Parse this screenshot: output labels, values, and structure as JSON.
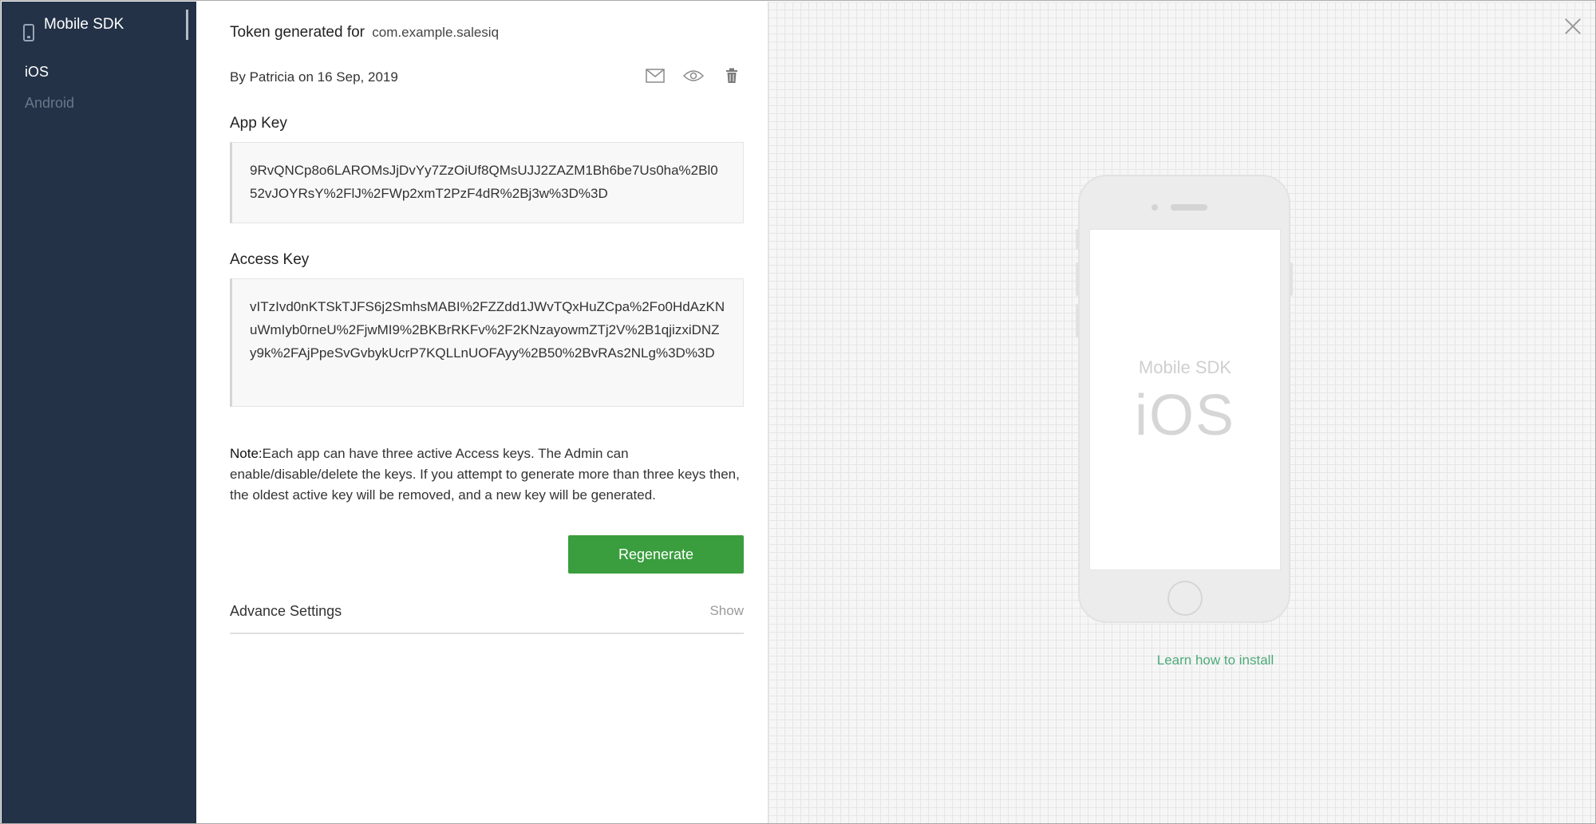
{
  "sidebar": {
    "title": "Mobile SDK",
    "items": [
      {
        "label": "iOS",
        "active": true
      },
      {
        "label": "Android",
        "active": false
      }
    ]
  },
  "token": {
    "prefix": "Token generated for",
    "package": "com.example.salesiq",
    "by_prefix": "By",
    "author": "Patricia",
    "on_word": "on",
    "date": "16 Sep, 2019"
  },
  "actions": {
    "icons": [
      "mail-icon",
      "eye-icon",
      "trash-icon"
    ]
  },
  "app_key": {
    "label": "App Key",
    "value": "9RvQNCp8o6LAROMsJjDvYy7ZzOiUf8QMsUJJ2ZAZM1Bh6be7Us0ha%2Bl052vJOYRsY%2FlJ%2FWp2xmT2PzF4dR%2Bj3w%3D%3D"
  },
  "access_key": {
    "label": "Access Key",
    "value": "vITzIvd0nKTSkTJFS6j2SmhsMABI%2FZZdd1JWvTQxHuZCpa%2Fo0HdAzKNuWmIyb0rneU%2FjwMI9%2BKBrRKFv%2F2KNzayowmZTj2V%2B1qjizxiDNZy9k%2FAjPpeSvGvbykUcrP7KQLLnUOFAyy%2B50%2BvRAs2NLg%3D%3D"
  },
  "note": {
    "label": "Note:",
    "text": "Each app can have three active Access keys. The Admin can enable/disable/delete the keys. If you attempt to generate more than three keys then, the oldest active key will be removed, and a new key will be generated."
  },
  "regenerate_label": "Regenerate",
  "advance": {
    "label": "Advance Settings",
    "toggle": "Show"
  },
  "preview": {
    "sdk_label": "Mobile SDK",
    "os_label": "iOS",
    "learn_link": "Learn how to install"
  },
  "colors": {
    "sidebar_bg": "#233247",
    "primary_button": "#3a9d3e",
    "link": "#4daa7a"
  }
}
